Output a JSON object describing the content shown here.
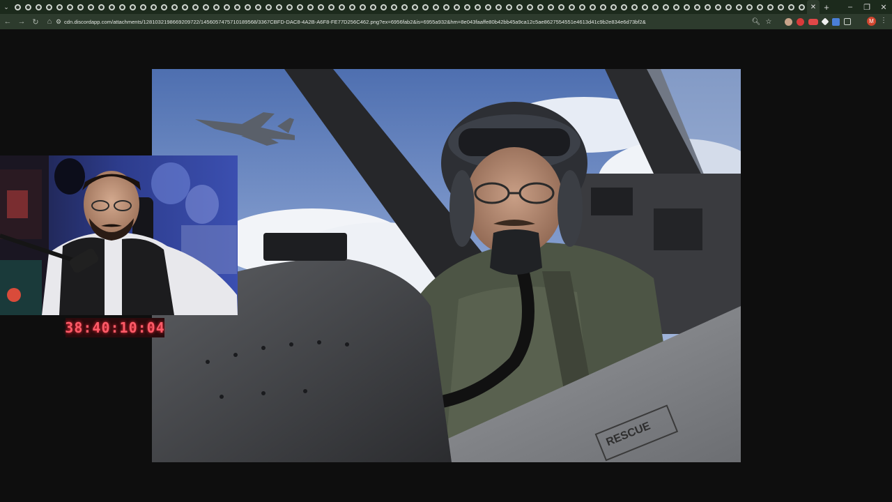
{
  "browser": {
    "tab_count": 76,
    "new_tab_label": "+",
    "url": "cdn.discordapp.com/attachments/1281032198669209722/1456057475710189568/3367CBFD-DAC8-4A2B-A6F8-FE77D256C462.png?ex=6956fab2&is=6955a932&hm=8e043faaffe80b42bb45a9ca12c5ae8627554551e4613d41c9b2e834e6d73bf2&",
    "profile_initial": "M",
    "accent": "#2d3b2d",
    "tab_strip_color": "#1c2a1c"
  },
  "icons": {
    "tab_menu": "chevron-down-icon",
    "back": "back-arrow-icon",
    "forward": "forward-arrow-icon",
    "reload": "reload-icon",
    "home": "home-icon",
    "site_info": "tune-icon",
    "zoom": "zoom-icon",
    "bookmark": "star-icon",
    "extensions": "puzzle-icon",
    "menu": "kebab-menu-icon",
    "minimize": "minimize-icon",
    "restore": "restore-icon",
    "close": "close-icon"
  },
  "overlay": {
    "timer": "38:40:10:04",
    "timer_color": "#ff5b68"
  }
}
